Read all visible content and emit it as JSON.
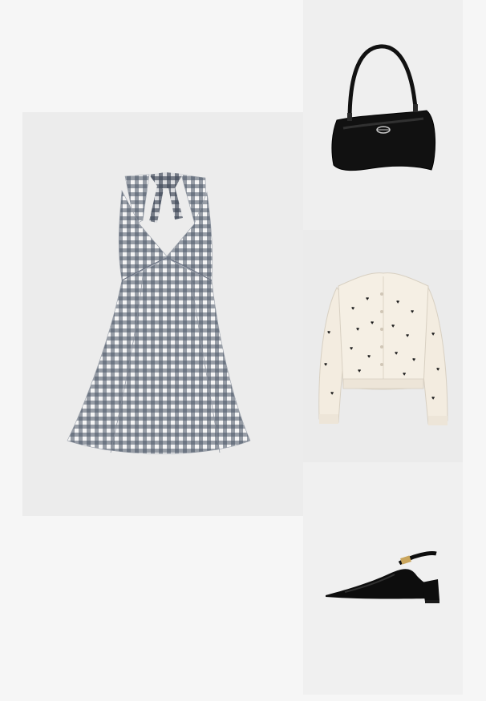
{
  "outfit": {
    "items": [
      {
        "id": "dress",
        "product": "gingham-halter-dress",
        "colors": {
          "check": "#4a5566",
          "base": "#f4f4f4"
        }
      },
      {
        "id": "bag",
        "product": "black-patent-shoulder-bag",
        "colors": {
          "body": "#111111",
          "hardware": "#c8c8c8"
        }
      },
      {
        "id": "cardigan",
        "product": "cream-heart-cardigan",
        "colors": {
          "knit": "#f3ece0",
          "hearts": "#1a1a1a"
        }
      },
      {
        "id": "shoe",
        "product": "black-patent-slingback-pump",
        "colors": {
          "leather": "#0d0d0d",
          "buckle": "#c9a55c"
        }
      }
    ],
    "colors": {
      "page_background": "#f6f6f6",
      "tile_background": "#ececec"
    }
  }
}
